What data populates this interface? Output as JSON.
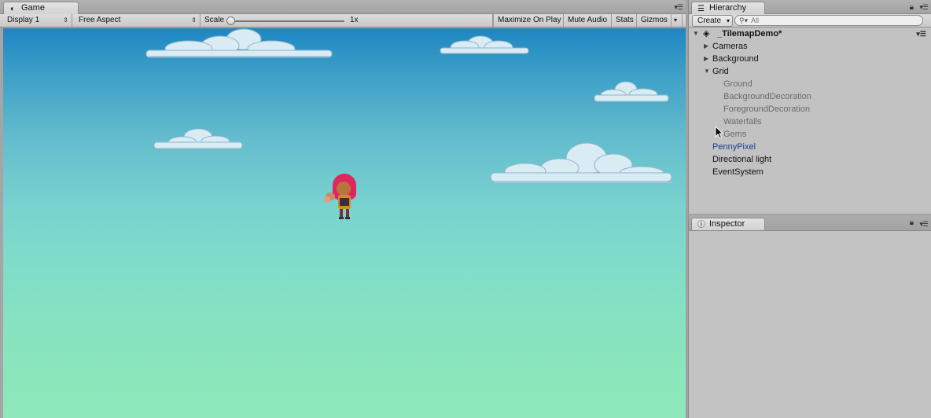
{
  "game": {
    "tab_label": "Game",
    "toolbar": {
      "display": "Display 1",
      "aspect": "Free Aspect",
      "scale_label": "Scale",
      "scale_value": "1x",
      "maximize": "Maximize On Play",
      "mute": "Mute Audio",
      "stats": "Stats",
      "gizmos": "Gizmos"
    }
  },
  "hierarchy": {
    "tab_label": "Hierarchy",
    "create_label": "Create",
    "search_placeholder": "All",
    "scene_name": "_TilemapDemo*",
    "items": [
      {
        "label": "Cameras",
        "depth": 1,
        "fold": "collapsed",
        "style": "normal"
      },
      {
        "label": "Background",
        "depth": 1,
        "fold": "collapsed",
        "style": "normal"
      },
      {
        "label": "Grid",
        "depth": 1,
        "fold": "expanded",
        "style": "normal"
      },
      {
        "label": "Ground",
        "depth": 2,
        "fold": "none",
        "style": "gray"
      },
      {
        "label": "BackgroundDecoration",
        "depth": 2,
        "fold": "none",
        "style": "gray"
      },
      {
        "label": "ForegroundDecoration",
        "depth": 2,
        "fold": "none",
        "style": "gray"
      },
      {
        "label": "Waterfalls",
        "depth": 2,
        "fold": "none",
        "style": "gray"
      },
      {
        "label": "Gems",
        "depth": 2,
        "fold": "none",
        "style": "gray"
      },
      {
        "label": "PennyPixel",
        "depth": 1,
        "fold": "none",
        "style": "blue"
      },
      {
        "label": "Directional light",
        "depth": 1,
        "fold": "none",
        "style": "normal"
      },
      {
        "label": "EventSystem",
        "depth": 1,
        "fold": "none",
        "style": "normal"
      }
    ]
  },
  "inspector": {
    "tab_label": "Inspector"
  },
  "colors": {
    "sky_top": "#1f86c2",
    "sky_bottom": "#8ee8b9",
    "selected_text": "#1b3d8f"
  }
}
